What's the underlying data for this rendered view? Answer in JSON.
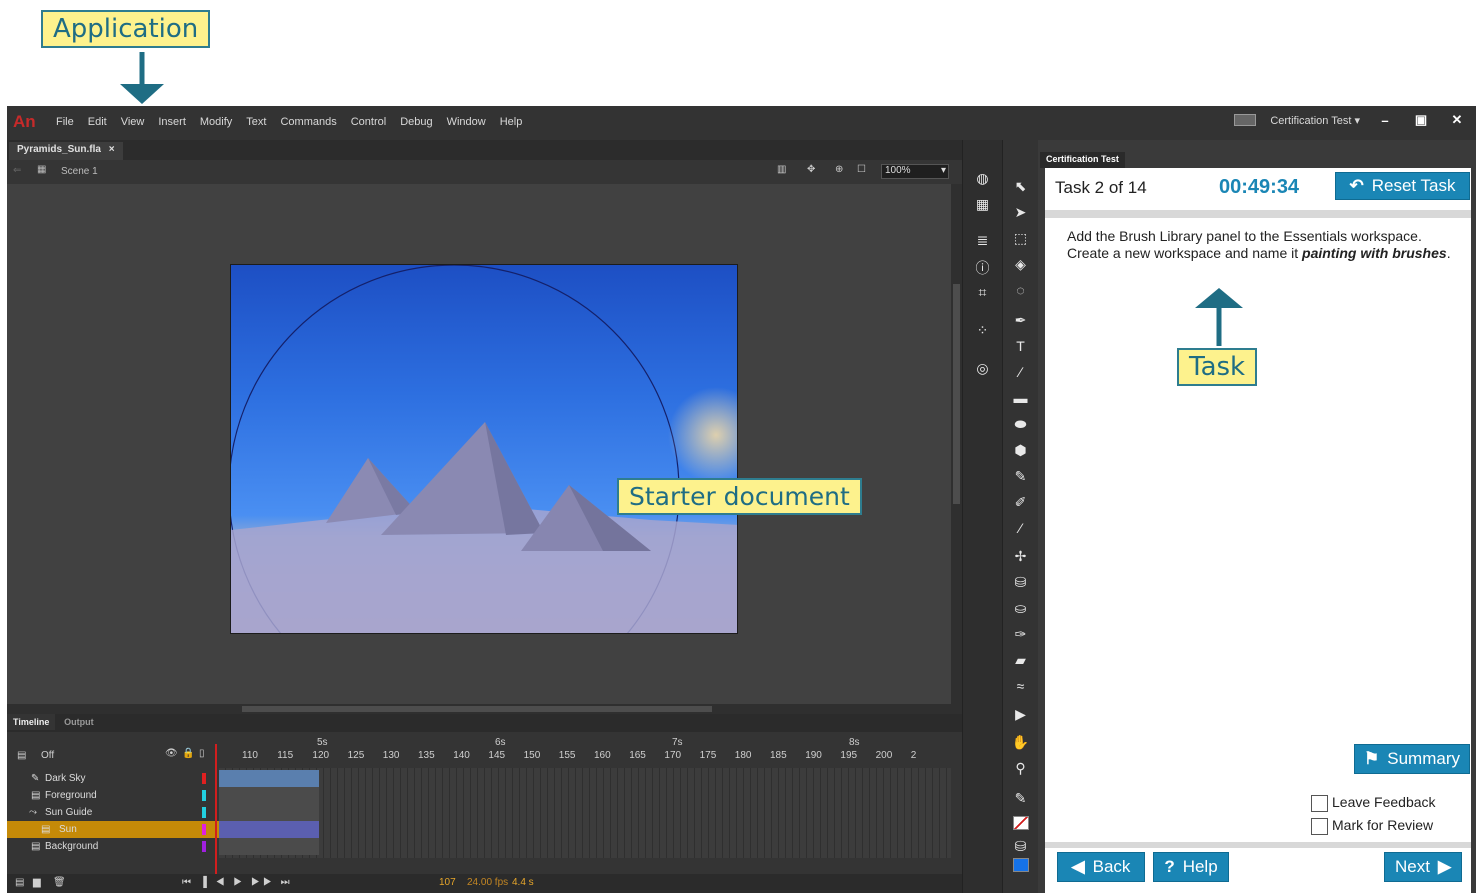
{
  "callouts": {
    "application": "Application",
    "starter": "Starter document",
    "task": "Task"
  },
  "menubar": {
    "logo": "An",
    "items": [
      "File",
      "Edit",
      "View",
      "Insert",
      "Modify",
      "Text",
      "Commands",
      "Control",
      "Debug",
      "Window",
      "Help"
    ],
    "workspace": "Certification Test",
    "min": "–",
    "restore": "▣",
    "close": "✕"
  },
  "document": {
    "tab_label": "Pyramids_Sun.fla",
    "tab_close": "×",
    "scene": "Scene 1",
    "zoom": "100%"
  },
  "timeline": {
    "tabs": [
      "Timeline",
      "Output"
    ],
    "onion_label": "Off",
    "ruler_seconds": [
      "5s",
      "6s",
      "7s",
      "8s"
    ],
    "ruler_frames": [
      "110",
      "115",
      "120",
      "125",
      "130",
      "135",
      "140",
      "145",
      "150",
      "155",
      "160",
      "165",
      "170",
      "175",
      "180",
      "185",
      "190",
      "195",
      "200",
      "2"
    ],
    "layers": [
      {
        "name": "Dark Sky",
        "color": "#e02020"
      },
      {
        "name": "Foreground",
        "color": "#22d0e0"
      },
      {
        "name": "Sun Guide",
        "color": "#22d0e0"
      },
      {
        "name": "Sun",
        "color": "#e020e0"
      },
      {
        "name": "Background",
        "color": "#a020e0"
      }
    ],
    "status_frame": "107",
    "status_fps": "24.00 fps",
    "status_time": "4.4 s"
  },
  "cert": {
    "panel_title": "Certification Test",
    "task_counter": "Task 2 of 14",
    "timer": "00:49:34",
    "reset_label": "Reset Task",
    "task_text_1": "Add the Brush Library panel to the Essentials workspace. Create a new workspace and name it ",
    "task_text_em": "painting with brushes",
    "task_text_end": ".",
    "summary_label": "Summary",
    "feedback_label": "Leave Feedback",
    "review_label": "Mark for Review",
    "back_label": "Back",
    "help_label": "Help",
    "next_label": "Next"
  },
  "colors": {
    "accent": "#1a86b5",
    "timer": "#1a86b5",
    "callout_bg": "#fdf28d",
    "callout_text": "#1f6d84"
  }
}
